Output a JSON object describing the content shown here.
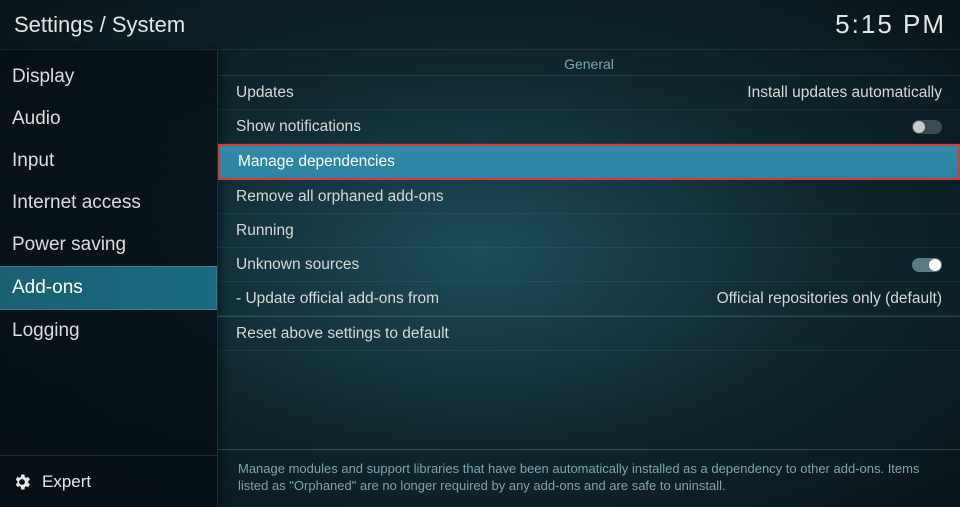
{
  "breadcrumb": "Settings / System",
  "clock": "5:15 PM",
  "sidebar": {
    "items": [
      {
        "label": "Display"
      },
      {
        "label": "Audio"
      },
      {
        "label": "Input"
      },
      {
        "label": "Internet access"
      },
      {
        "label": "Power saving"
      },
      {
        "label": "Add-ons"
      },
      {
        "label": "Logging"
      }
    ],
    "selected_index": 5,
    "level_label": "Expert"
  },
  "content": {
    "section_title": "General",
    "rows": [
      {
        "label": "Updates",
        "value": "Install updates automatically",
        "kind": "value"
      },
      {
        "label": "Show notifications",
        "kind": "toggle",
        "on": false
      },
      {
        "label": "Manage dependencies",
        "kind": "action",
        "highlighted": true
      },
      {
        "label": "Remove all orphaned add-ons",
        "kind": "action"
      },
      {
        "label": "Running",
        "kind": "action"
      },
      {
        "label": "Unknown sources",
        "kind": "toggle",
        "on": true
      },
      {
        "label": "- Update official add-ons from",
        "value": "Official repositories only (default)",
        "kind": "value"
      },
      {
        "label": "Reset above settings to default",
        "kind": "action",
        "sep_before": true
      }
    ]
  },
  "footer": "Manage modules and support libraries that have been automatically installed as a dependency to other add-ons. Items listed as \"Orphaned\" are no longer required by any add-ons and are safe to uninstall."
}
